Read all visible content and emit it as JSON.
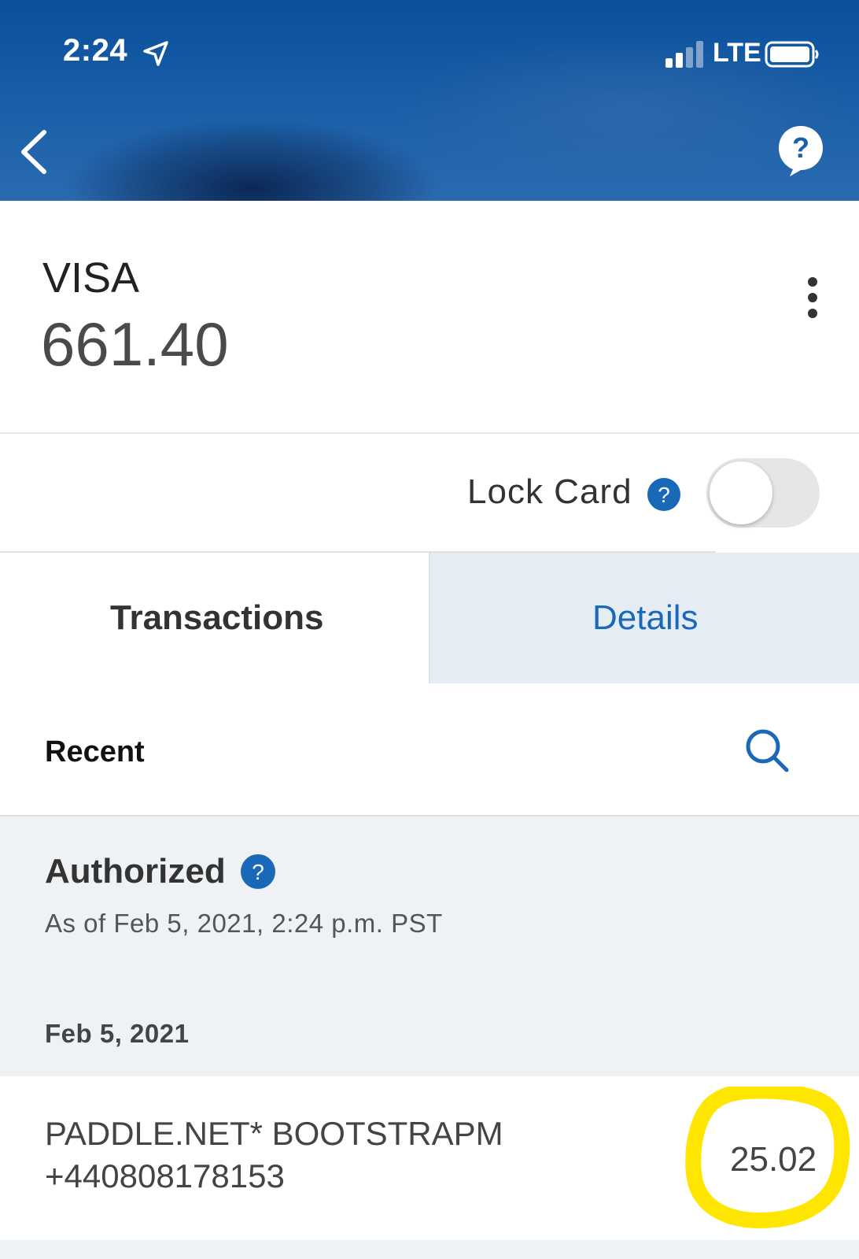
{
  "status_bar": {
    "time": "2:24",
    "network": "LTE"
  },
  "header": {
    "icons": [
      "back-chevron-icon",
      "help-bubble-icon"
    ]
  },
  "card": {
    "name": "VISA",
    "balance": "661.40",
    "icons": [
      "more-vertical-icon"
    ]
  },
  "lock_card": {
    "label": "Lock Card",
    "locked": false
  },
  "tabs": [
    {
      "label": "Transactions",
      "selected": true
    },
    {
      "label": "Details",
      "selected": false
    }
  ],
  "recent": {
    "label": "Recent"
  },
  "authorized": {
    "title": "Authorized",
    "as_of": "As of Feb 5, 2021, 2:24 p.m. PST"
  },
  "transactions": [
    {
      "date": "Feb 5, 2021",
      "description_line1": "PADDLE.NET* BOOTSTRAPM",
      "description_line2": "+440808178153",
      "amount": "25.02"
    }
  ],
  "colors": {
    "header_blue": "#0a4f9a",
    "accent_blue": "#1a68b8",
    "tab_selected_bg": "#ffffff",
    "tab_unselected_bg": "#e5ecf4",
    "section_bg": "#eef2f5",
    "highlight_yellow": "#ffe600"
  }
}
